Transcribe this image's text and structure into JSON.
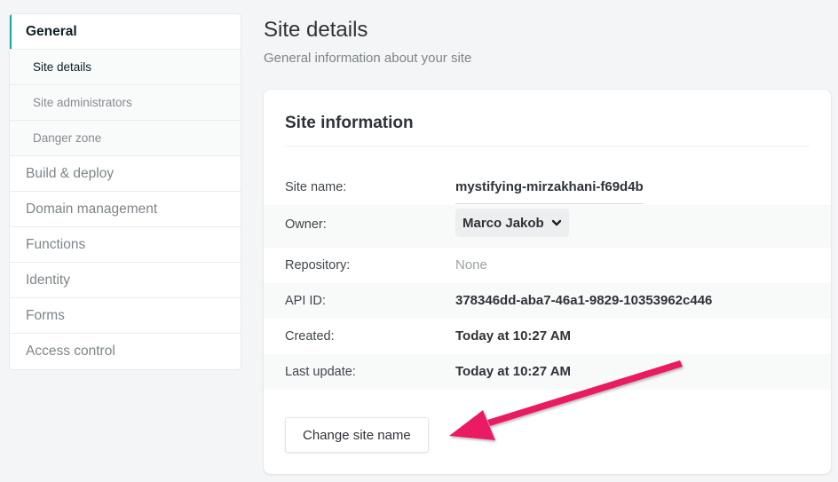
{
  "sidebar": {
    "items": [
      {
        "label": "General",
        "active": true
      },
      {
        "label": "Site details",
        "sub": true,
        "current": true
      },
      {
        "label": "Site administrators",
        "sub": true
      },
      {
        "label": "Danger zone",
        "sub": true
      },
      {
        "label": "Build & deploy"
      },
      {
        "label": "Domain management"
      },
      {
        "label": "Functions"
      },
      {
        "label": "Identity"
      },
      {
        "label": "Forms"
      },
      {
        "label": "Access control"
      }
    ]
  },
  "header": {
    "title": "Site details",
    "subtitle": "General information about your site"
  },
  "card": {
    "title": "Site information",
    "rows": {
      "site_name": {
        "label": "Site name:",
        "value": "mystifying-mirzakhani-f69d4b"
      },
      "owner": {
        "label": "Owner:",
        "value": "Marco Jakob",
        "icon": "chevron-down-icon"
      },
      "repository": {
        "label": "Repository:",
        "value": "None"
      },
      "api_id": {
        "label": "API ID:",
        "value": "378346dd-aba7-46a1-9829-10353962c446"
      },
      "created": {
        "label": "Created:",
        "value": "Today at 10:27 AM"
      },
      "last_update": {
        "label": "Last update:",
        "value": "Today at 10:27 AM"
      }
    },
    "button_label": "Change site name"
  },
  "annotation": {
    "type": "arrow",
    "color": "#e91e63",
    "points_to": "Change site name"
  },
  "colors": {
    "accent": "#15a8a0",
    "background": "#f3f5f6"
  }
}
